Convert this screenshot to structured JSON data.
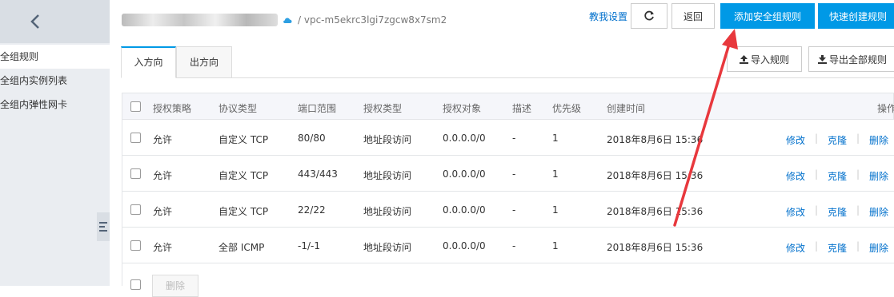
{
  "sidebar": {
    "items": [
      {
        "label": "全组规则",
        "active": true
      },
      {
        "label": "全组内实例列表",
        "active": false
      },
      {
        "label": "全组内弹性网卡",
        "active": false
      }
    ]
  },
  "header": {
    "vpc_id": "/ vpc-m5ekrc3lgi7zgcw8x7sm2",
    "tutorial_label": "教我设置",
    "back_label": "返回",
    "add_rule_label": "添加安全组规则",
    "quick_create_label": "快速创建规则"
  },
  "tabs": [
    {
      "label": "入方向",
      "active": true
    },
    {
      "label": "出方向",
      "active": false
    }
  ],
  "toolbar": {
    "import_label": "导入规则",
    "export_label": "导出全部规则"
  },
  "table": {
    "headers": {
      "policy": "授权策略",
      "protocol": "协议类型",
      "port": "端口范围",
      "auth_type": "授权类型",
      "auth_object": "授权对象",
      "description": "描述",
      "priority": "优先级",
      "created": "创建时间",
      "actions": "操作"
    },
    "rows": [
      {
        "policy": "允许",
        "protocol": "自定义 TCP",
        "port": "80/80",
        "auth_type": "地址段访问",
        "auth_object": "0.0.0.0/0",
        "description": "-",
        "priority": "1",
        "created": "2018年8月6日 15:36"
      },
      {
        "policy": "允许",
        "protocol": "自定义 TCP",
        "port": "443/443",
        "auth_type": "地址段访问",
        "auth_object": "0.0.0.0/0",
        "description": "-",
        "priority": "1",
        "created": "2018年8月6日 15:36"
      },
      {
        "policy": "允许",
        "protocol": "自定义 TCP",
        "port": "22/22",
        "auth_type": "地址段访问",
        "auth_object": "0.0.0.0/0",
        "description": "-",
        "priority": "1",
        "created": "2018年8月6日 15:36"
      },
      {
        "policy": "允许",
        "protocol": "全部 ICMP",
        "port": "-1/-1",
        "auth_type": "地址段访问",
        "auth_object": "0.0.0.0/0",
        "description": "-",
        "priority": "1",
        "created": "2018年8月6日 15:36"
      }
    ],
    "actions": {
      "modify": "修改",
      "clone": "克隆",
      "delete": "删除"
    }
  },
  "footer": {
    "batch_delete_label": "删除"
  },
  "colors": {
    "primary": "#0099e6",
    "link": "#0070cc",
    "annotation_arrow": "#e8383d"
  },
  "icons": [
    "chevron-left-icon",
    "cloud-icon",
    "refresh-icon",
    "upload-icon",
    "download-icon",
    "collapse-icon"
  ]
}
